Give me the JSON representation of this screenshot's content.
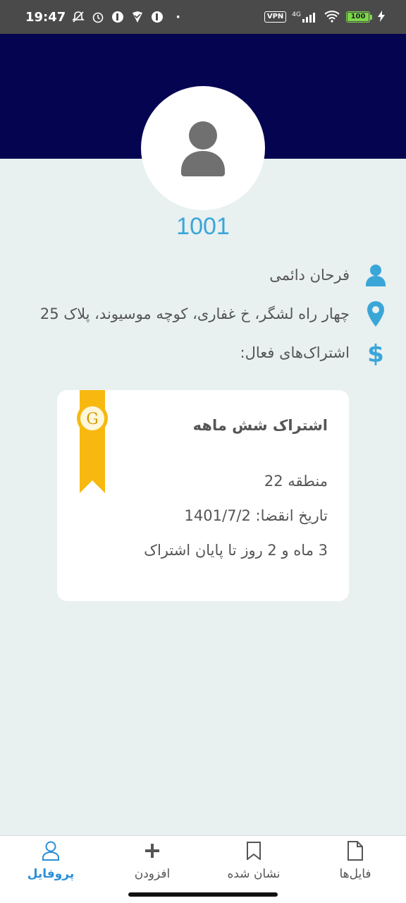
{
  "status_bar": {
    "time": "19:47",
    "vpn": "VPN",
    "network": "4G",
    "battery": "100"
  },
  "profile": {
    "user_code": "1001",
    "name": "فرحان دائمی",
    "address": "چهار راه لشگر، خ غفاری، کوچه موسیوند، پلاک 25",
    "subscriptions_label": "اشتراک‌های فعال:"
  },
  "subscription_card": {
    "title": "اشتراک شش ماهه",
    "badge_letter": "G",
    "region": "منطقه 22",
    "expiry": "تاریخ انقضا: 1401/7/2",
    "remaining": "3 ماه و 2 روز تا پایان اشتراک"
  },
  "colors": {
    "header": "#040450",
    "accent": "#3aa6d8",
    "ribbon": "#f7b90f",
    "background": "#e8f0f0"
  },
  "bottom_nav": {
    "items": [
      {
        "label": "پروفایل",
        "icon": "user-outline-icon",
        "active": true
      },
      {
        "label": "افزودن",
        "icon": "plus-icon",
        "active": false
      },
      {
        "label": "نشان شده",
        "icon": "bookmark-icon",
        "active": false
      },
      {
        "label": "فایل‌ها",
        "icon": "file-icon",
        "active": false
      }
    ]
  }
}
